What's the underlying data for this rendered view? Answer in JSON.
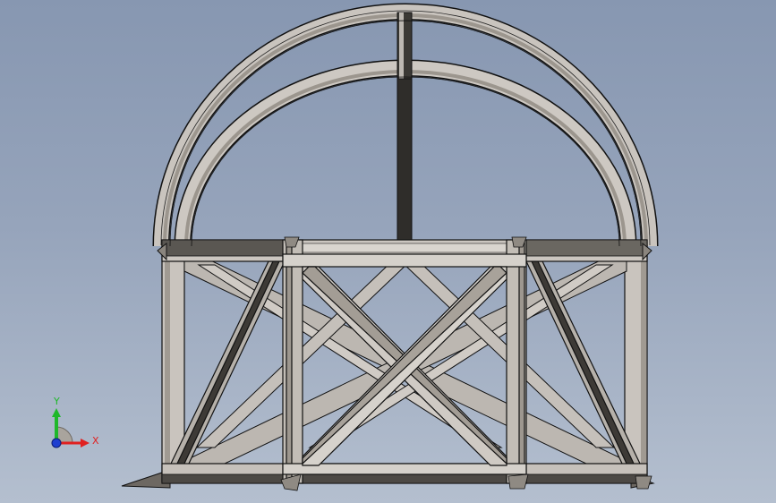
{
  "viewport": {
    "model": "truss-frame",
    "colors": {
      "member_face": "#cfcac4",
      "member_side": "#9a948c",
      "member_dark": "#3a3835",
      "edge": "#111111"
    }
  },
  "triad": {
    "x_label": "X",
    "y_label": "Y",
    "colors": {
      "x": "#e02020",
      "y": "#1fb82a",
      "z": "#1f3fd0",
      "plane": "#a9a49d"
    }
  }
}
